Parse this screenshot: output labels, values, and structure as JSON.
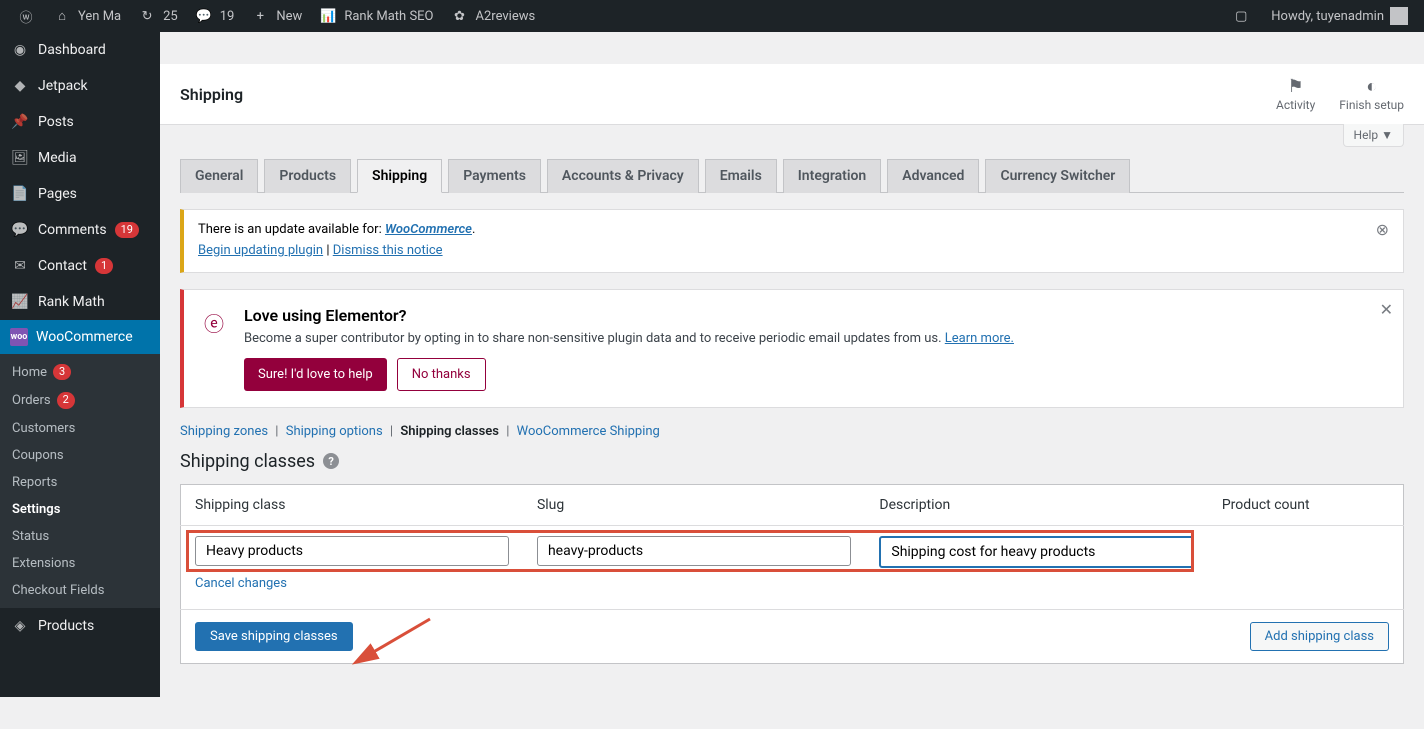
{
  "adminbar": {
    "site_name": "Yen Ma",
    "updates": "25",
    "comments": "19",
    "new": "New",
    "rankmath": "Rank Math SEO",
    "a2reviews": "A2reviews",
    "howdy": "Howdy, tuyenadmin"
  },
  "sidebar": {
    "items": [
      {
        "label": "Dashboard",
        "icon": "dashboard"
      },
      {
        "label": "Jetpack",
        "icon": "jetpack"
      },
      {
        "label": "Posts",
        "icon": "pin"
      },
      {
        "label": "Media",
        "icon": "media"
      },
      {
        "label": "Pages",
        "icon": "pages"
      },
      {
        "label": "Comments",
        "icon": "comments",
        "badge": "19"
      },
      {
        "label": "Contact",
        "icon": "contact",
        "badge": "1"
      },
      {
        "label": "Rank Math",
        "icon": "rankmath"
      },
      {
        "label": "WooCommerce",
        "icon": "woo",
        "current": true
      }
    ],
    "submenu": [
      {
        "label": "Home",
        "badge": "3"
      },
      {
        "label": "Orders",
        "badge": "2"
      },
      {
        "label": "Customers"
      },
      {
        "label": "Coupons"
      },
      {
        "label": "Reports"
      },
      {
        "label": "Settings",
        "current": true
      },
      {
        "label": "Status"
      },
      {
        "label": "Extensions"
      },
      {
        "label": "Checkout Fields"
      }
    ],
    "products": "Products"
  },
  "header": {
    "title": "Shipping",
    "activity": "Activity",
    "finish": "Finish setup"
  },
  "help": "Help",
  "tabs": [
    "General",
    "Products",
    "Shipping",
    "Payments",
    "Accounts & Privacy",
    "Emails",
    "Integration",
    "Advanced",
    "Currency Switcher"
  ],
  "active_tab": 2,
  "update_notice": {
    "text": "There is an update available for: ",
    "link": "WooCommerce",
    "begin": "Begin updating plugin",
    "dismiss": "Dismiss this notice"
  },
  "elementor": {
    "title": "Love using Elementor?",
    "body": "Become a super contributor by opting in to share non-sensitive plugin data and to receive periodic email updates from us. ",
    "learn": "Learn more.",
    "yes": "Sure! I'd love to help",
    "no": "No thanks"
  },
  "subnav": {
    "zones": "Shipping zones",
    "options": "Shipping options",
    "classes": "Shipping classes",
    "wcship": "WooCommerce Shipping"
  },
  "section": {
    "title": "Shipping classes"
  },
  "table": {
    "headers": [
      "Shipping class",
      "Slug",
      "Description",
      "Product count"
    ],
    "row": {
      "class": "Heavy products",
      "slug": "heavy-products",
      "desc": "Shipping cost for heavy products"
    },
    "cancel": "Cancel changes",
    "save": "Save shipping classes",
    "add": "Add shipping class"
  }
}
